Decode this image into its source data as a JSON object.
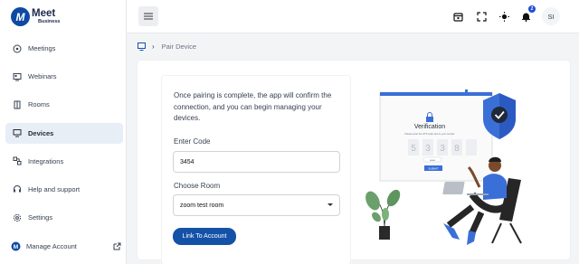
{
  "logo": {
    "mark": "M",
    "title": "Meet",
    "subtitle": "Business"
  },
  "sidebar": {
    "items": [
      {
        "label": "Meetings",
        "icon": "chat-bubble-icon"
      },
      {
        "label": "Webinars",
        "icon": "presentation-icon"
      },
      {
        "label": "Rooms",
        "icon": "door-icon"
      },
      {
        "label": "Devices",
        "icon": "device-icon",
        "active": true
      },
      {
        "label": "Integrations",
        "icon": "integrations-icon"
      },
      {
        "label": "Help and support",
        "icon": "headset-icon"
      },
      {
        "label": "Settings",
        "icon": "gear-icon"
      }
    ],
    "manage_account": "Manage Account"
  },
  "header": {
    "icons": [
      "calendar-icon",
      "fullscreen-icon",
      "brightness-icon",
      "bell-icon"
    ],
    "notification_count": "2",
    "avatar_initials": "SI"
  },
  "breadcrumb": {
    "current": "Pair Device"
  },
  "form": {
    "description": "Once pairing is complete, the app will confirm the connection, and you can begin managing your devices.",
    "code_label": "Enter Code",
    "code_value": "3454",
    "room_label": "Choose Room",
    "room_value": "zoom test room",
    "submit_label": "Link To Account"
  },
  "illustration": {
    "title": "Verification",
    "caption": "Please enter the OTP code sent to your number",
    "digits": [
      "5",
      "3",
      "3",
      "8",
      ""
    ],
    "button": "SUBMIT"
  },
  "colors": {
    "brand": "#1452a8",
    "active_bg": "#e8eef6",
    "accent_illus": "#3b6fd8"
  }
}
